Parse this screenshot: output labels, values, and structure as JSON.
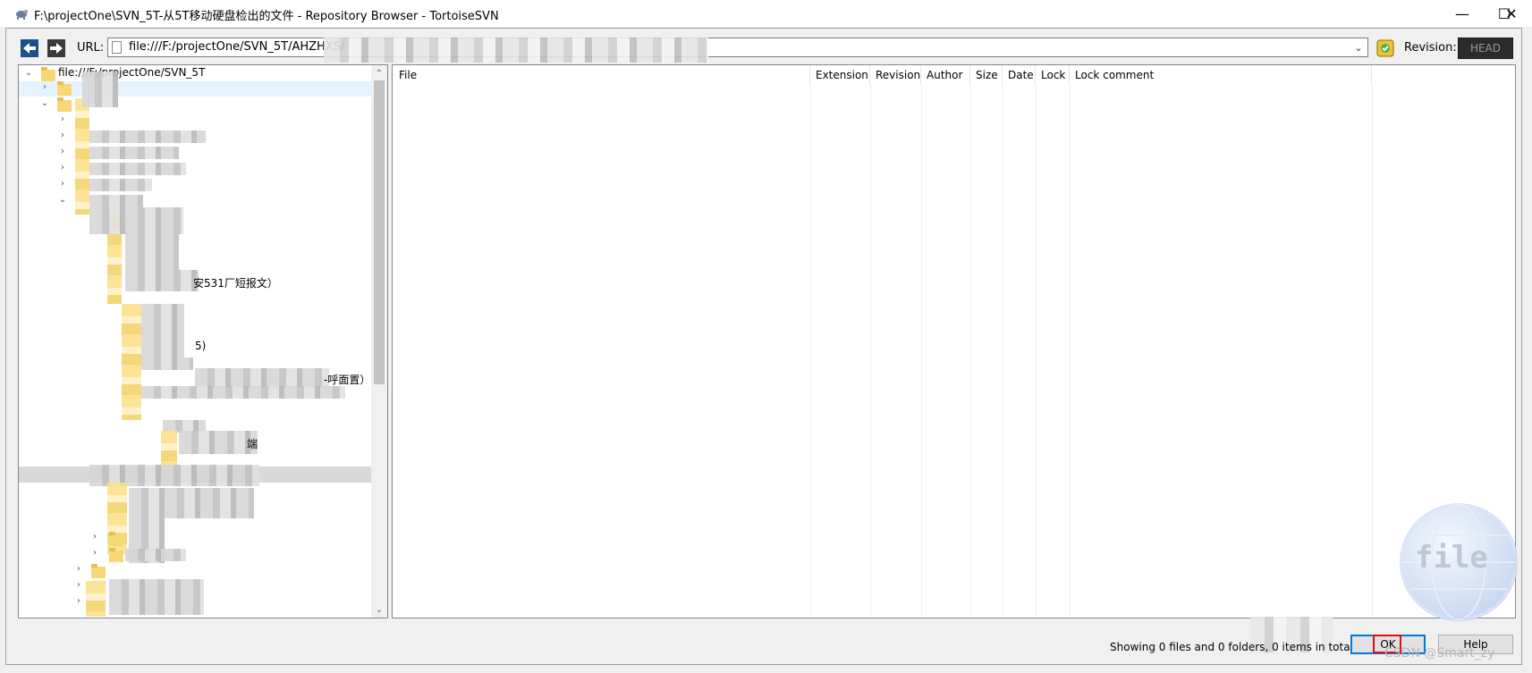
{
  "window": {
    "title": "F:\\projectOne\\SVN_5T-从5T移动硬盘检出的文件 - Repository Browser - TortoiseSVN",
    "minimize": "—",
    "maximize": "☐",
    "close": "✕"
  },
  "toolbar": {
    "url_label": "URL:",
    "url_value": "file:///F:/projectOne/SVN_5T/AHZHXS/",
    "revision_label": "Revision:",
    "revision_value": "HEAD"
  },
  "tree": {
    "root_label": "file:///F:/projectOne/SVN_5T",
    "partial_labels": [
      {
        "text": "安531厂短报文）"
      },
      {
        "text": "5)"
      },
      {
        "text": "-呼面置）"
      },
      {
        "text": "端"
      }
    ]
  },
  "file_list": {
    "columns": [
      "File",
      "Extension",
      "Revision",
      "Author",
      "Size",
      "Date",
      "Lock",
      "Lock comment"
    ]
  },
  "footer": {
    "status_text": "Showing 0 files and 0 folders, 0 items in total",
    "ok_label": "OK",
    "help_label": "Help",
    "watermark_word": "file",
    "csdn_mark": "CSDN @Smart_zy"
  },
  "colors": {
    "accent": "#0078d7",
    "highlight_box": "#e01010",
    "folder": "#f8d775"
  }
}
